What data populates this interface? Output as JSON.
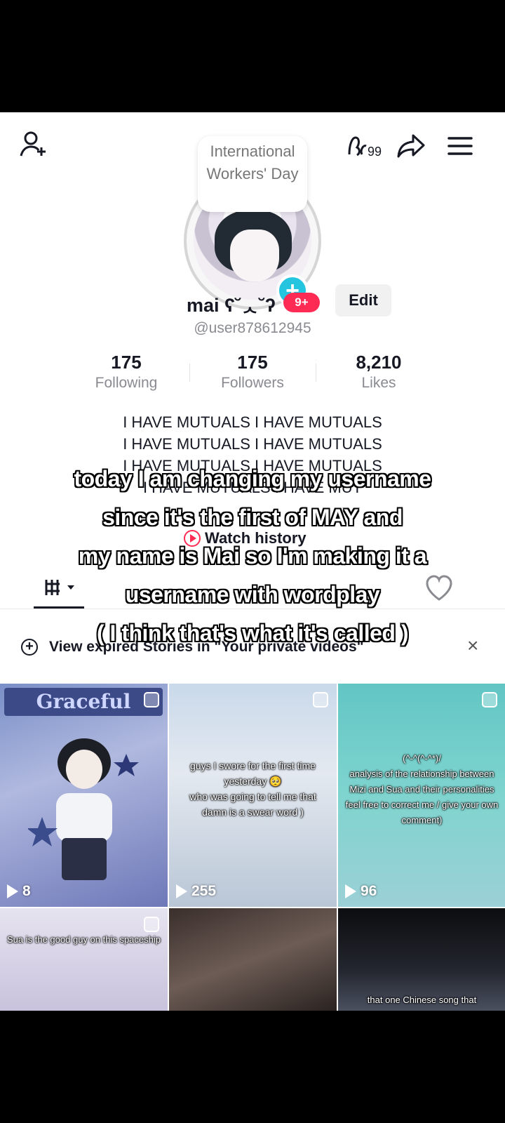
{
  "profile": {
    "note_text": "International Workers' Day",
    "display_name": "mai ʕ˘ᆺ˘ʔ",
    "badge": "9+",
    "edit_label": "Edit",
    "handle": "@user878612945",
    "creator_count": "99"
  },
  "stats": [
    {
      "value": "175",
      "label": "Following"
    },
    {
      "value": "175",
      "label": "Followers"
    },
    {
      "value": "8,210",
      "label": "Likes"
    }
  ],
  "bio": {
    "lines": [
      "I HAVE MUTUALS I HAVE MUTUALS",
      "I HAVE MUTUALS I HAVE MUTUALS",
      "I HAVE MUTUALS I HAVE MUTUALS",
      "I HAVE MUTUALS I HAVE MUT"
    ],
    "watch_history_label": "Watch history"
  },
  "stories_banner": {
    "text": "View expired Stories in \"Your private videos\"",
    "close_label": "×"
  },
  "videos": [
    {
      "count": "8",
      "banner": "Graceful",
      "caption": ""
    },
    {
      "count": "255",
      "caption_lines": [
        "guys I swore for the first time",
        "yesterday 🥺",
        "who was going to tell me that",
        "damn is a swear word )"
      ]
    },
    {
      "count": "96",
      "caption_lines": [
        "(^-^(^-^*)/",
        "analysis of the relationship between",
        "Mizi and Sua and their personalities",
        "feel free to correct me / give your own",
        "comment)"
      ]
    },
    {
      "count": "",
      "caption_lines": [
        "Sua is the good guy on this spaceship"
      ]
    },
    {
      "count": "",
      "caption_lines": []
    },
    {
      "count": "",
      "caption_lines": [
        "that one Chinese song that"
      ]
    }
  ],
  "subtitle": {
    "lines": [
      "today I am changing my username",
      "since it's the first of  MAY and",
      "my name is Mai so I'm making it a",
      "username with wordplay",
      "( I think that's what it's called )"
    ]
  },
  "colors": {
    "accent_pink": "#fe2c55",
    "avatar_plus": "#25c4df",
    "text_primary": "#161823",
    "text_secondary": "#8a8b91"
  },
  "icons": [
    "add-friend-icon",
    "creator-tools-icon",
    "share-icon",
    "menu-icon",
    "grid-icon",
    "liked-heart-icon",
    "plus-circle-icon",
    "close-icon",
    "play-icon"
  ]
}
